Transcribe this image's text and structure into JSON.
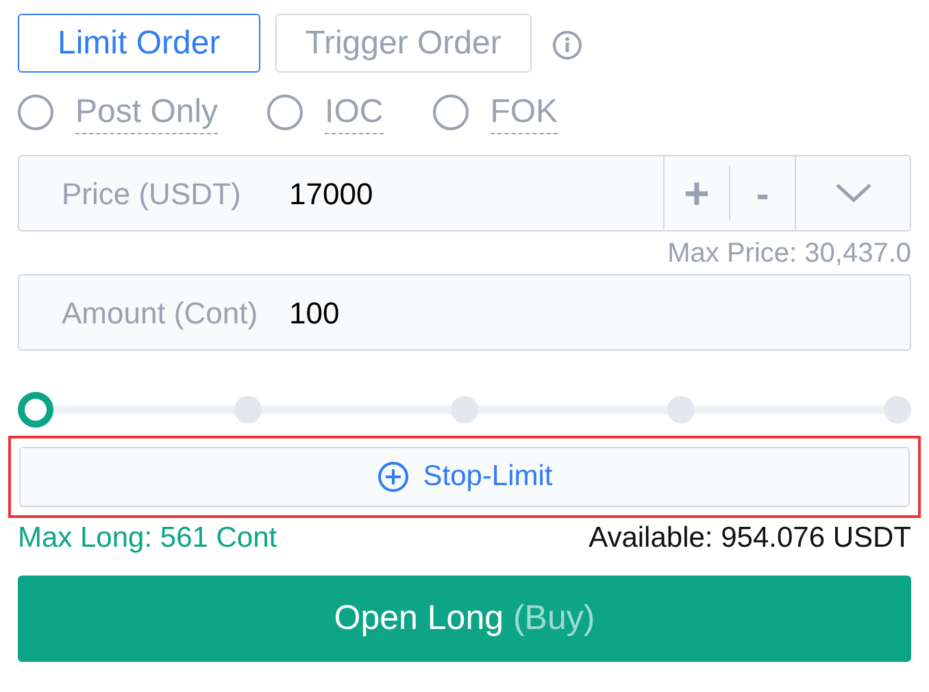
{
  "tabs": [
    {
      "label": "Limit Order",
      "selected": true
    },
    {
      "label": "Trigger Order",
      "selected": false
    }
  ],
  "options": [
    {
      "label": "Post Only",
      "checked": false
    },
    {
      "label": "IOC",
      "checked": false
    },
    {
      "label": "FOK",
      "checked": false
    }
  ],
  "price_field": {
    "label": "Price (USDT)",
    "value": "17000",
    "plus": "+",
    "minus": "-"
  },
  "max_price": "Max Price: 30,437.0",
  "amount_field": {
    "label": "Amount (Cont)",
    "value": "100"
  },
  "slider": {
    "level": 0
  },
  "stop_limit": {
    "label": "Stop-Limit",
    "highlighted": true
  },
  "max_long": "Max Long: 561 Cont",
  "available": "Available: 954.076 USDT",
  "submit": {
    "label": "Open Long",
    "hint": "(Buy)"
  }
}
